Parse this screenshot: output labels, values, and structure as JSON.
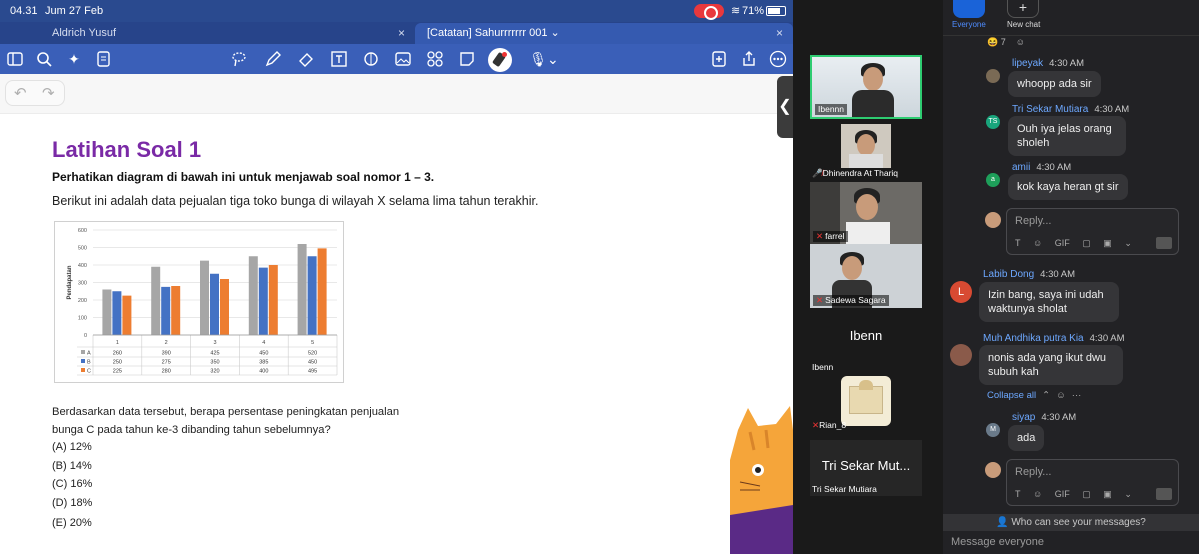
{
  "status_bar": {
    "time": "04.31",
    "date": "Jum 27 Feb",
    "battery": "71%"
  },
  "tabs": [
    {
      "label": "Aldrich Yusuf",
      "close": "×"
    },
    {
      "label": "[Catatan] Sahurrrrrrr 001 ⌄",
      "close": "×"
    }
  ],
  "toolbar": {
    "icons": [
      "sidebar-icon",
      "search-icon",
      "ai-sparkle-icon",
      "document-icon",
      "lasso-icon",
      "pen-icon",
      "eraser-icon",
      "text-box-icon",
      "shape-icon",
      "image-icon",
      "elements-icon",
      "sticky-note-icon",
      "laser-pointer-icon",
      "microphone-icon",
      "add-page-icon",
      "share-icon",
      "more-icon"
    ]
  },
  "page": {
    "title": "Latihan Soal 1",
    "instruction": "Perhatikan diagram di bawah ini untuk menjawab soal nomor 1 – 3.",
    "intro": "Berikut ini adalah data pejualan tiga toko bunga di wilayah X selama lima tahun terakhir.",
    "question_line1": "Berdasarkan data tersebut, berapa persentase peningkatan penjualan",
    "question_line2": "bunga C pada tahun ke-3 dibanding tahun sebelumnya?",
    "options": [
      "(A) 12%",
      "(B) 14%",
      "(C) 16%",
      "(D) 18%",
      "(E) 20%"
    ]
  },
  "chart_data": {
    "type": "bar",
    "categories": [
      "1",
      "2",
      "3",
      "4",
      "5"
    ],
    "series": [
      {
        "name": "A",
        "values": [
          260,
          390,
          425,
          450,
          520
        ],
        "color": "#a6a6a6"
      },
      {
        "name": "B",
        "values": [
          250,
          275,
          350,
          385,
          450
        ],
        "color": "#4472c4"
      },
      {
        "name": "C",
        "values": [
          225,
          280,
          320,
          400,
          495
        ],
        "color": "#ed7d31"
      }
    ],
    "ylabel": "Pendapatan",
    "ylim": [
      0,
      600
    ],
    "yticks": [
      0,
      100,
      200,
      300,
      400,
      500,
      600
    ],
    "grid": true,
    "legend": "table-below"
  },
  "gallery": {
    "tiles": [
      {
        "name": "Ibennn",
        "muted": false
      },
      {
        "name": "Dhinendra At Thariq",
        "muted": true
      },
      {
        "name": "farrel",
        "muted": true
      },
      {
        "name": "Sadewa Sagara",
        "muted": true
      },
      {
        "name": "Rian_8",
        "muted": true
      }
    ],
    "name_tiles": [
      {
        "big": "Ibenn",
        "small": "Ibenn"
      },
      {
        "big": "Tri Sekar Mut...",
        "small": "Tri Sekar Mutiara"
      }
    ]
  },
  "chat": {
    "everyone_label": "Everyone",
    "new_chat_label": "New chat",
    "top_reactions": "😆 7",
    "messages": [
      {
        "sender": "lipeyak",
        "time": "4:30 AM",
        "text": "whoopp ada sir",
        "initials": ""
      },
      {
        "sender": "Tri Sekar Mutiara",
        "time": "4:30 AM",
        "text": "Ouh iya jelas orang sholeh",
        "initials": "TS"
      },
      {
        "sender": "amii",
        "time": "4:30 AM",
        "text": "kok kaya heran gt sir",
        "initials": "a"
      },
      {
        "sender": "Labib Dong",
        "time": "4:30 AM",
        "text": "Izin bang, saya ini udah waktunya sholat",
        "initials": "L"
      },
      {
        "sender": "Muh Andhika putra Kia",
        "time": "4:30 AM",
        "text": "nonis ada yang ikut dwu subuh kah",
        "initials": ""
      },
      {
        "sender": "siyap",
        "time": "4:30 AM",
        "text": "ada",
        "initials": "M"
      }
    ],
    "reply_placeholder": "Reply...",
    "reply_tools": [
      "T",
      "☺",
      "GIF",
      "▢",
      "▣",
      "⌄"
    ],
    "collapse_all": "Collapse all",
    "who_can_see": "Who can see your messages?",
    "message_placeholder": "Message everyone"
  }
}
